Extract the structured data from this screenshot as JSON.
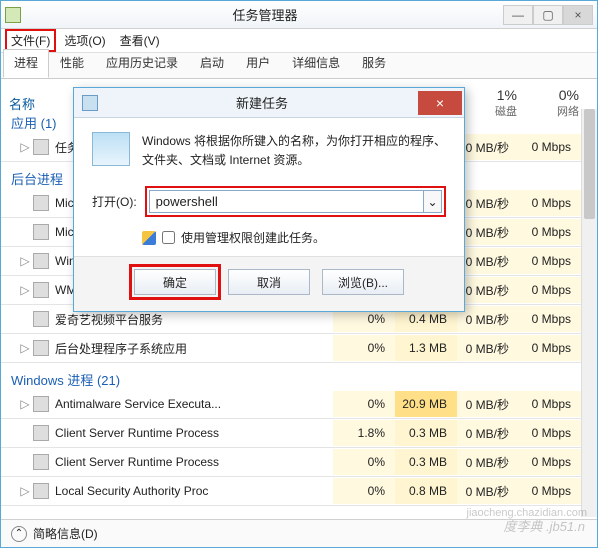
{
  "window": {
    "title": "任务管理器",
    "btn_min": "—",
    "btn_max": "▢",
    "btn_close": "×"
  },
  "menu": {
    "file": "文件(F)",
    "options": "选项(O)",
    "view": "查看(V)"
  },
  "tabs": [
    "进程",
    "性能",
    "应用历史记录",
    "启动",
    "用户",
    "详细信息",
    "服务"
  ],
  "active_tab": 0,
  "cols": {
    "name": "名称",
    "disk_pct": "1%",
    "disk_lbl": "磁盘",
    "net_pct": "0%",
    "net_lbl": "网络"
  },
  "groups": [
    {
      "label": "应用 (1)",
      "rows": [
        {
          "icon": "taskmgr",
          "name": "任务",
          "cpu": "",
          "mem": "",
          "disk": "0 MB/秒",
          "net": "0 Mbps",
          "expand": "▷"
        }
      ]
    },
    {
      "label": "后台进程",
      "rows": [
        {
          "icon": "app",
          "name": "Micr",
          "disk": "0 MB/秒",
          "net": "0 Mbps"
        },
        {
          "icon": "app",
          "name": "Micr",
          "disk": "0 MB/秒",
          "net": "0 Mbps"
        },
        {
          "icon": "win",
          "name": "Win",
          "disk": "0 MB/秒",
          "net": "0 Mbps",
          "expand": "▷"
        },
        {
          "icon": "svc",
          "name": "WM",
          "disk": "0 MB/秒",
          "net": "0 Mbps",
          "expand": "▷"
        },
        {
          "icon": "iqiyi",
          "name": "爱奇艺视频平台服务",
          "cpu": "0%",
          "mem": "0.4 MB",
          "disk": "0 MB/秒",
          "net": "0 Mbps"
        },
        {
          "icon": "svc",
          "name": "后台处理程序子系统应用",
          "cpu": "0%",
          "mem": "1.3 MB",
          "disk": "0 MB/秒",
          "net": "0 Mbps",
          "expand": "▷"
        }
      ]
    },
    {
      "label": "Windows 进程 (21)",
      "rows": [
        {
          "icon": "shield",
          "name": "Antimalware Service Executa...",
          "cpu": "0%",
          "mem": "20.9 MB",
          "disk": "0 MB/秒",
          "net": "0 Mbps",
          "expand": "▷"
        },
        {
          "icon": "svc",
          "name": "Client Server Runtime Process",
          "cpu": "1.8%",
          "mem": "0.3 MB",
          "disk": "0 MB/秒",
          "net": "0 Mbps"
        },
        {
          "icon": "svc",
          "name": "Client Server Runtime Process",
          "cpu": "0%",
          "mem": "0.3 MB",
          "disk": "0 MB/秒",
          "net": "0 Mbps"
        },
        {
          "icon": "svc",
          "name": "Local Security Authority Proc",
          "cpu": "0%",
          "mem": "0.8 MB",
          "disk": "0 MB/秒",
          "net": "0 Mbps",
          "expand": "▷"
        }
      ]
    }
  ],
  "footer": {
    "up": "⌃",
    "label": "简略信息(D)"
  },
  "watermark": "度李典   .jb51.n",
  "watermark2": "jiaocheng.chazidian.com",
  "dialog": {
    "title": "新建任务",
    "msg": "Windows 将根据你所键入的名称，为你打开相应的程序、文件夹、文档或 Internet 资源。",
    "open_lbl": "打开(O):",
    "input_value": "powershell",
    "admin_lbl": "使用管理权限创建此任务。",
    "ok": "确定",
    "cancel": "取消",
    "browse": "浏览(B)...",
    "close": "×",
    "dd": "⌄"
  }
}
